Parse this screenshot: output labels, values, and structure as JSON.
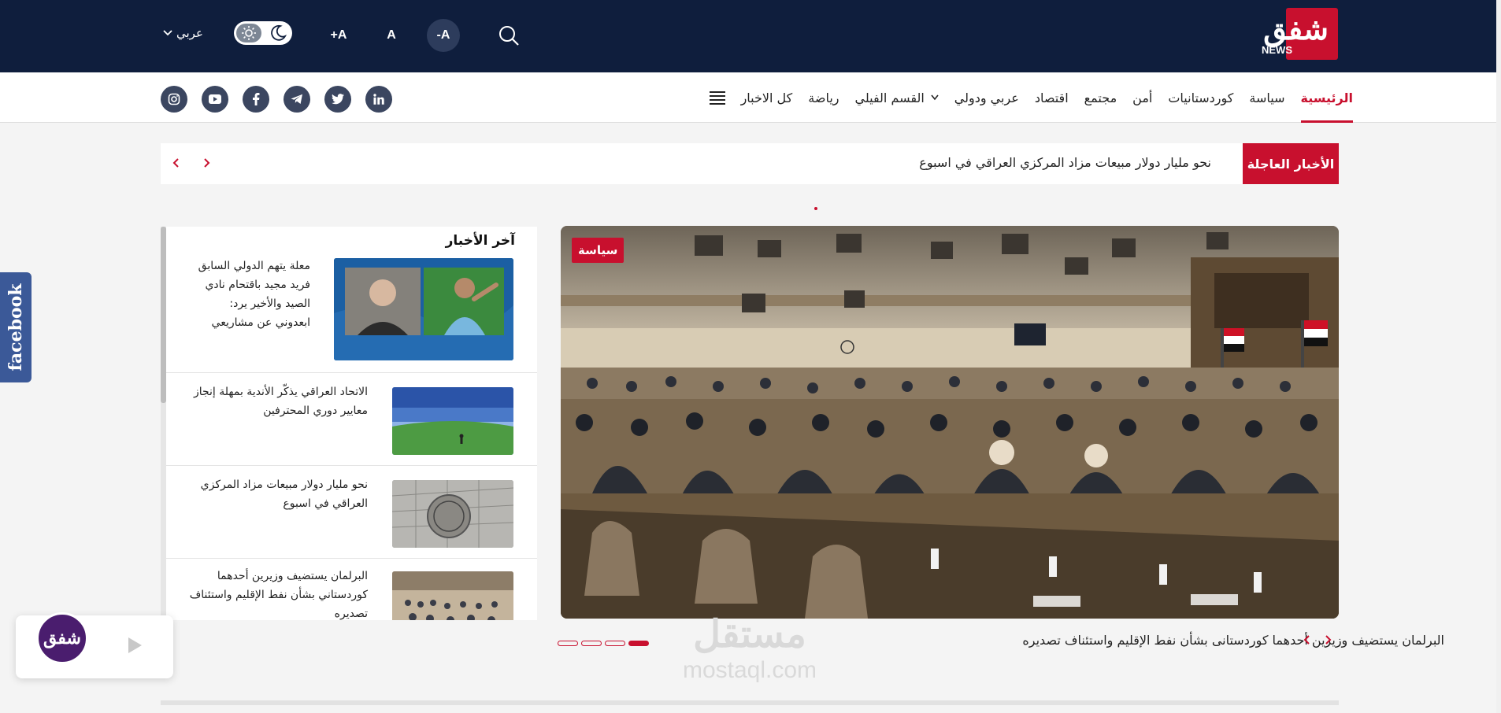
{
  "header": {
    "logo_ar": "شفق",
    "logo_en": "NEWS",
    "font_sizes": [
      "-A",
      "A",
      "+A"
    ],
    "language": "عربي",
    "colors": {
      "topbar": "#0f1e3d",
      "accent": "#c8102e"
    }
  },
  "nav": {
    "items": [
      "الرئيسية",
      "سياسة",
      "كوردستانيات",
      "أمن",
      "مجتمع",
      "اقتصاد",
      "عربي ودولي",
      "القسم الفيلي",
      "رياضة",
      "كل الاخبار"
    ],
    "active": "الرئيسية",
    "social": [
      "linkedin-icon",
      "twitter-icon",
      "telegram-icon",
      "facebook-icon",
      "youtube-icon",
      "instagram-icon"
    ]
  },
  "breaking": {
    "label": "الأخبار العاجلة",
    "headline": "نحو مليار دولار مبيعات مزاد المركزي العراقي في اسبوع"
  },
  "latest": {
    "title": "آخر الأخبار",
    "items": [
      {
        "text": "معلة يتهم الدولي السابق فريد مجيد باقتحام نادي الصيد والأخير يرد: ابعدوني عن مشاريعي"
      },
      {
        "text": "الاتحاد العراقي يذكّر الأندية بمهلة إنجاز معايير دوري المحترفين"
      },
      {
        "text": "نحو مليار دولار مبيعات مزاد المركزي العراقي في اسبوع"
      },
      {
        "text": "البرلمان يستضيف وزيرين أحدهما كوردستاني بشأن نفط الإقليم واستئناف تصديره"
      }
    ]
  },
  "hero": {
    "category": "سياسة",
    "caption": "البرلمان يستضيف وزيرين أحدهما كوردستانى بشأن نفط الإقليم واستئناف تصديره",
    "slides": 4,
    "active_slide": 4
  },
  "watermark": {
    "ar": "مستقل",
    "en": "mostaql.com"
  },
  "facebook_tab": "facebook",
  "radio": {
    "logo": "شفق"
  }
}
